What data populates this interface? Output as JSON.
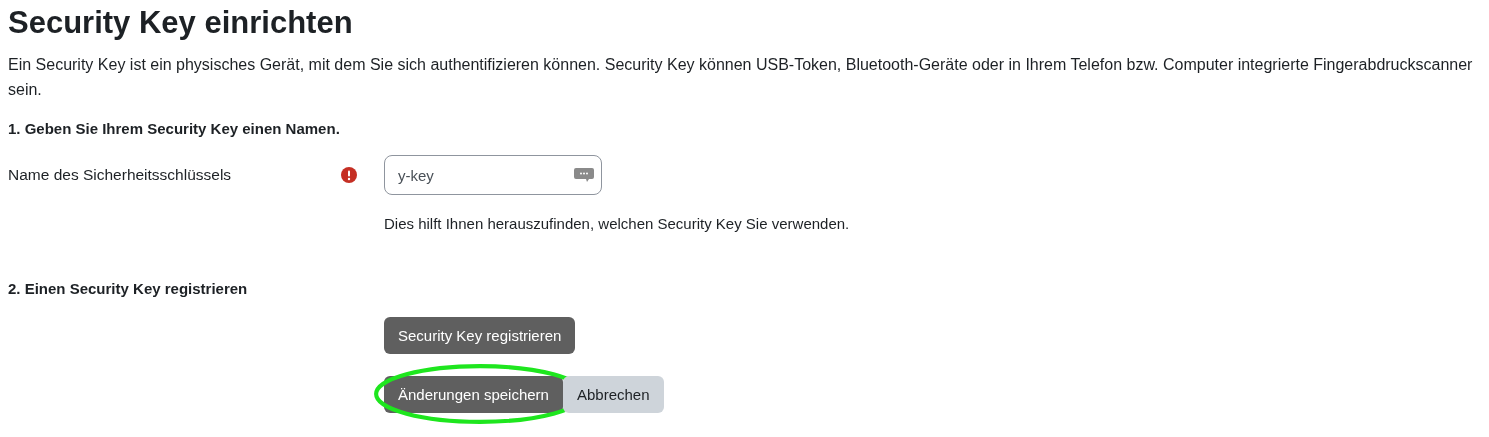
{
  "title": "Security Key einrichten",
  "intro": "Ein Security Key ist ein physisches Gerät, mit dem Sie sich authentifizieren können. Security Key können USB-Token, Bluetooth-Geräte oder in Ihrem Telefon bzw. Computer integrierte Fingerabdruckscanner sein.",
  "step1": {
    "heading": "1. Geben Sie Ihrem Security Key einen Namen.",
    "label": "Name des Sicherheitsschlüssels",
    "required": true,
    "value": "y-key",
    "help": "Dies hilft Ihnen herauszufinden, welchen Security Key Sie verwenden."
  },
  "step2": {
    "heading": "2. Einen Security Key registrieren",
    "button": "Security Key registrieren"
  },
  "actions": [
    {
      "label": "Änderungen speichern",
      "kind": "primary",
      "highlighted": true
    },
    {
      "label": "Abbrechen",
      "kind": "secondary",
      "highlighted": false
    }
  ]
}
